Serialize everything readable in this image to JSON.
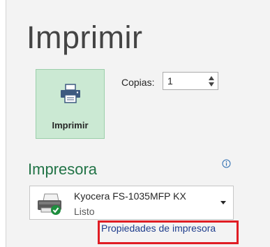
{
  "page": {
    "title": "Imprimir"
  },
  "print_button": {
    "label": "Imprimir",
    "icon": "printer-icon"
  },
  "copies": {
    "label": "Copias:",
    "value": "1"
  },
  "printer_section": {
    "title": "Impresora",
    "info_icon": "info-icon",
    "selected_printer": {
      "name": "Kyocera FS-1035MFP KX",
      "status": "Listo",
      "icon": "printer-ready-icon"
    },
    "properties_link": "Propiedades de impresora"
  },
  "colors": {
    "accent_green": "#217346",
    "print_button_bg": "#cbe9d3",
    "link_blue": "#1f3d8c",
    "highlight_red": "#e01d24"
  }
}
